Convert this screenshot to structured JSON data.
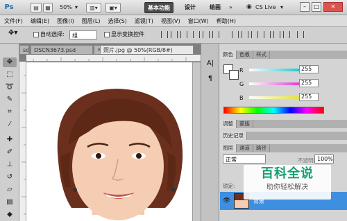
{
  "app": {
    "logo": "Ps"
  },
  "titlebar": {
    "zoom": "50%",
    "workspaces": [
      "基本功能",
      "设计",
      "绘画"
    ],
    "more": "»",
    "cs_live": "CS Live",
    "win_minimize": "–",
    "win_restore": "□",
    "win_close": "✕"
  },
  "menu": [
    "文件(F)",
    "编辑(E)",
    "图像(I)",
    "图层(L)",
    "选择(S)",
    "滤镜(T)",
    "视图(V)",
    "窗口(W)",
    "帮助(H)"
  ],
  "options": {
    "auto_select_label": "自动选择:",
    "auto_select_value": "组",
    "show_transform_label": "显示变换控件"
  },
  "tabs": [
    {
      "label": "sd"
    },
    {
      "label": "DSCN3673.psd"
    },
    {
      "label": "照片.jpg @ 50%(RGB/8#)"
    }
  ],
  "color_panel": {
    "tabs": [
      "颜色",
      "色板",
      "样式"
    ],
    "r_label": "R",
    "r_value": "255",
    "g_label": "G",
    "g_value": "255",
    "b_label": "B",
    "b_value": "255",
    "r_color": "#21c7d6",
    "g_color": "#e53bd7",
    "b_color": "#e4e23b"
  },
  "adjust_panel": {
    "tabs": [
      "调整",
      "蒙版"
    ]
  },
  "history_panel": {
    "tabs": [
      "历史记录"
    ]
  },
  "layers_panel": {
    "tabs": [
      "图层",
      "通道",
      "路径"
    ],
    "blend_mode": "正常",
    "opacity_label": "不透明度:",
    "opacity_value": "100%",
    "lock_label": "锁定:",
    "layer_name": "背景"
  },
  "watermark": {
    "title": "百科全说",
    "subtitle": "助你轻松解决"
  }
}
